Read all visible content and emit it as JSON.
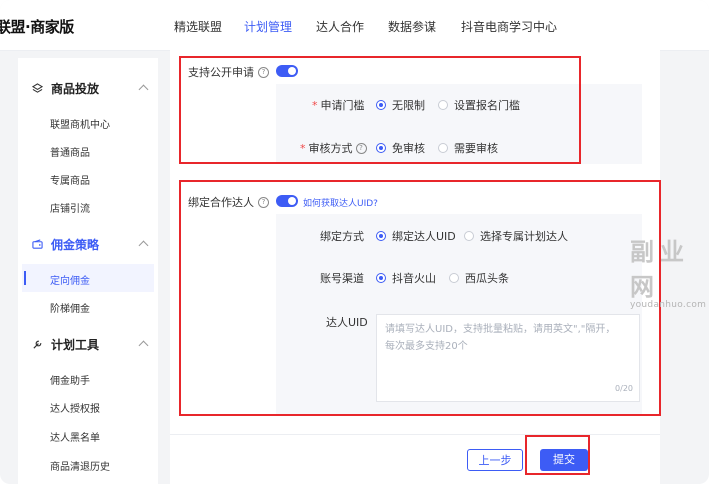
{
  "header": {
    "logo": "联盟·商家版",
    "nav": [
      "精选联盟",
      "计划管理",
      "达人合作",
      "数据参谋",
      "抖音电商学习中心"
    ],
    "active_nav_index": 1
  },
  "sidebar": {
    "groups": [
      {
        "label": "商品投放",
        "items": [
          "联盟商机中心",
          "普通商品",
          "专属商品",
          "店铺引流"
        ]
      },
      {
        "label": "佣金策略",
        "items": [
          "定向佣金",
          "阶梯佣金"
        ]
      },
      {
        "label": "计划工具",
        "items": [
          "佣金助手",
          "达人授权报",
          "达人黑名单",
          "商品清退历史"
        ]
      }
    ],
    "active_item": "定向佣金"
  },
  "public_apply": {
    "label": "支持公开申请",
    "toggle_on": true,
    "threshold": {
      "label": "申请门槛",
      "options": [
        "无限制",
        "设置报名门槛"
      ],
      "selected": 0
    },
    "review": {
      "label": "审核方式",
      "options": [
        "免审核",
        "需要审核"
      ],
      "selected": 0
    }
  },
  "bind_creator": {
    "label": "绑定合作达人",
    "toggle_on": true,
    "help_link": "如何获取达人UID?",
    "bind_method": {
      "label": "绑定方式",
      "options": [
        "绑定达人UID",
        "选择专属计划达人"
      ],
      "selected": 0
    },
    "account_channel": {
      "label": "账号渠道",
      "options": [
        "抖音火山",
        "西瓜头条"
      ],
      "selected": 0
    },
    "uid": {
      "label": "达人UID",
      "placeholder_line1": "请填写达人UID，支持批量粘贴，请用英文\",\"隔开，",
      "placeholder_line2": "每次最多支持20个",
      "counter": "0/20"
    }
  },
  "footer": {
    "prev_label": "上一步",
    "submit_label": "提交"
  },
  "watermark": {
    "title": "副业网",
    "url": "youdanhuo.com"
  },
  "colors": {
    "accent": "#3d5cf5",
    "highlight_box": "#e8262b",
    "required": "#f04848"
  }
}
